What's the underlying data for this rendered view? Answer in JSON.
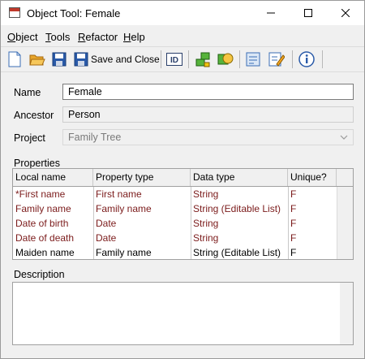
{
  "window": {
    "title": "Object Tool: Female"
  },
  "menu": [
    {
      "label": "Object",
      "u": "O",
      "rest": "bject"
    },
    {
      "label": "Tools",
      "u": "T",
      "rest": "ools"
    },
    {
      "label": "Refactor",
      "u": "R",
      "rest": "efactor"
    },
    {
      "label": "Help",
      "u": "H",
      "rest": "elp"
    }
  ],
  "toolbar": {
    "save_close_label": "Save and Close",
    "id_label": "ID"
  },
  "form": {
    "name_label": "Name",
    "name_value": "Female",
    "ancestor_label": "Ancestor",
    "ancestor_value": "Person",
    "project_label": "Project",
    "project_value": "Family Tree"
  },
  "properties": {
    "label": "Properties",
    "columns": [
      "Local name",
      "Property type",
      "Data type",
      "Unique?"
    ],
    "rows": [
      {
        "local": "*First name",
        "ptype": "First name",
        "dtype": "String",
        "unique": "F",
        "inherited": true
      },
      {
        "local": "Family name",
        "ptype": "Family name",
        "dtype": "String (Editable List)",
        "unique": "F",
        "inherited": true
      },
      {
        "local": "Date of birth",
        "ptype": "Date",
        "dtype": "String",
        "unique": "F",
        "inherited": true
      },
      {
        "local": "Date of death",
        "ptype": "Date",
        "dtype": "String",
        "unique": "F",
        "inherited": true
      },
      {
        "local": "Maiden name",
        "ptype": "Family name",
        "dtype": "String (Editable List)",
        "unique": "F",
        "inherited": false
      }
    ]
  },
  "description": {
    "label": "Description",
    "value": ""
  },
  "colors": {
    "inherited_text": "#7b1b1b",
    "own_text": "#000000",
    "row_highlight_border": "#9b2a2a"
  }
}
